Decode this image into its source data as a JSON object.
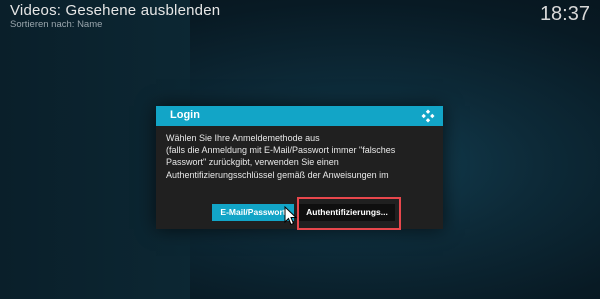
{
  "header": {
    "title": "Videos: Gesehene ausblenden",
    "subtitle": "Sortieren nach: Name",
    "clock": "18:37"
  },
  "dialog": {
    "title": "Login",
    "icon": "kodi-logo-icon",
    "message_lines": [
      "Wählen Sie Ihre Anmeldemethode aus",
      "(falls die Anmeldung mit E-Mail/Passwort immer \"falsches",
      "Passwort\" zurückgibt, verwenden Sie einen",
      "Authentifizierungsschlüssel gemäß der Anweisungen im"
    ],
    "buttons": {
      "email": "E-Mail/Passwort",
      "auth": "Authentifizierungs..."
    }
  },
  "colors": {
    "accent": "#12a5c7",
    "dialog_bg": "#202020",
    "highlight": "#e8474c"
  }
}
